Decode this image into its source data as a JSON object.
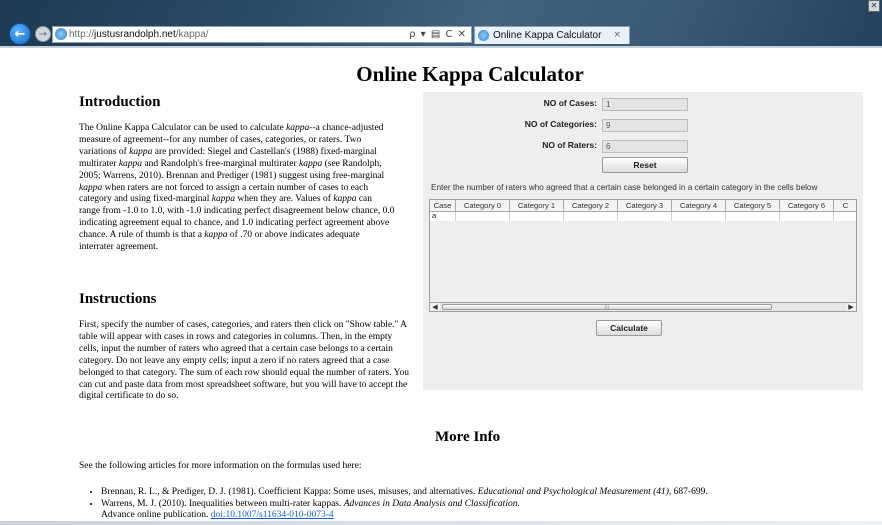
{
  "browser": {
    "url_prefix": "http://",
    "url_host": "justusrandolph.net",
    "url_path": "/kappa/",
    "addr_tools": "ρ ▾ ▤ C ✕",
    "tab_title": "Online Kappa Calculator",
    "tab_close": "×",
    "back_icon": "←",
    "forward_icon": "→",
    "close_glyph": "✕"
  },
  "page": {
    "title": "Online Kappa Calculator",
    "intro_heading": "Introduction",
    "intro_parts": [
      "The Online Kappa Calculator can be used to calculate ",
      "kappa",
      "--a chance-adjusted measure of agreement--for any number of cases, categories, or raters. Two variations of ",
      "kappa",
      " are provided: Siegel and Castellan's (1988) fixed-marginal multirater ",
      "kappa",
      " and Randolph's free-marginal multirater ",
      "kappa",
      " (see Randolph, 2005; Warrens, 2010). Brennan and Prediger (1981) suggest using free-marginal ",
      "kappa",
      " when raters are not forced to assign a certain number of cases to each category and using fixed-marginal ",
      "kappa",
      " when they are. Values of ",
      "kappa",
      " can range from -1.0 to 1.0, with -1.0 indicating perfect disagreement below chance, 0.0 indicating agreement equal to chance, and 1.0 indicating perfect agreement above chance. A rule of thumb is that a ",
      "kappa",
      " of .70 or above indicates adequate interrater agreement."
    ],
    "instructions_heading": "Instructions",
    "instructions_text": "First, specify the number of cases, categories, and raters then click on \"Show table.\" A table will appear with cases in rows and categories in columns. Then, in the empty cells, input the number of raters who agreed that a certain case belongs to a certain category. Do not leave any empty cells; input a zero if no raters agreed that a case belonged to that category. The sum of each row should equal the number of raters. You can cut and paste data from most spreadsheet software, but you will have to accept the digital certificate to do so.",
    "more_info_heading": "More Info",
    "see_text": "See the following articles for more information on the formulas used here:",
    "refs": [
      {
        "text": "Brennan, R. L., & Prediger, D. J. (1981). Coefficient Kappa: Some uses, misuses, and alternatives. ",
        "journal": "Educational and Psychological Measurement (41)",
        "tail": ", 687-699."
      },
      {
        "text": "Warrens, M. J. (2010). Inequalities between multi-rater kappas. ",
        "journal": "Advances in Data Analysis and Classification.",
        "tail": "",
        "line2": "Advance online publication. ",
        "doi": "doi:10.1007/s11634-010-0073-4"
      }
    ]
  },
  "applet": {
    "cases_label": "NO of Cases:",
    "cases_value": "1",
    "categories_label": "NO of Categories:",
    "categories_value": "9",
    "raters_label": "NO of Raters:",
    "raters_value": "6",
    "reset_label": "Reset",
    "instruction": "Enter the number of raters who agreed that a certain case belonged in a certain category in the cells below",
    "columns": [
      "Case",
      "Category 0",
      "Category 1",
      "Category 2",
      "Category 3",
      "Category 4",
      "Category 5",
      "Category 6",
      "C"
    ],
    "rows": [
      [
        "a",
        "",
        "",
        "",
        "",
        "",
        "",
        "",
        ""
      ]
    ],
    "scroll_left": "◀",
    "scroll_right": "▶",
    "scroll_grip": "|||",
    "calculate_label": "Calculate"
  }
}
